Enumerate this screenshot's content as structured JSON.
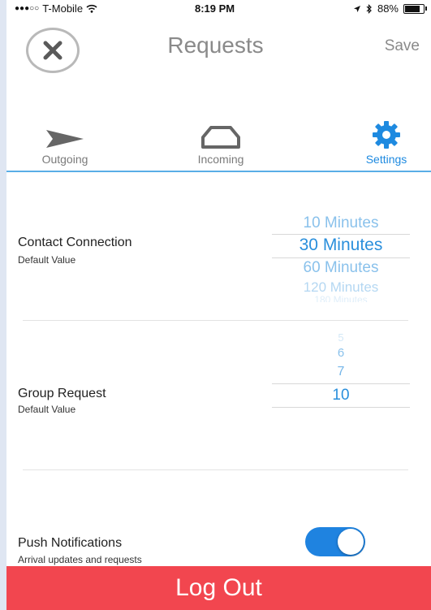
{
  "status_bar": {
    "signal_dots": "●●●○○",
    "carrier": "T-Mobile",
    "time": "8:19 PM",
    "battery": "88%",
    "battery_level": 0.88
  },
  "header": {
    "title": "Requests",
    "save_label": "Save"
  },
  "tabs": [
    {
      "label": "Outgoing",
      "icon": "send-arrow-icon",
      "active": false
    },
    {
      "label": "Incoming",
      "icon": "inbox-tray-icon",
      "active": false
    },
    {
      "label": "Settings",
      "icon": "gear-icon",
      "active": true
    }
  ],
  "settings": {
    "contact_connection": {
      "title": "Contact Connection",
      "subtitle": "Default Value",
      "options": [
        "10 Minutes",
        "30 Minutes",
        "60 Minutes",
        "120 Minutes",
        "180 Minutes"
      ],
      "selected": "30 Minutes"
    },
    "group_request": {
      "title": "Group Request",
      "subtitle": "Default Value",
      "options": [
        "5",
        "6",
        "7",
        "10"
      ],
      "selected": "10"
    },
    "push_notifications": {
      "title": "Push Notifications",
      "subtitle": "Arrival updates and requests",
      "enabled": true
    }
  },
  "logout_label": "Log Out",
  "colors": {
    "accent": "#1e8ae0",
    "logout": "#f2464f",
    "toggle_on": "#1f83e0"
  }
}
